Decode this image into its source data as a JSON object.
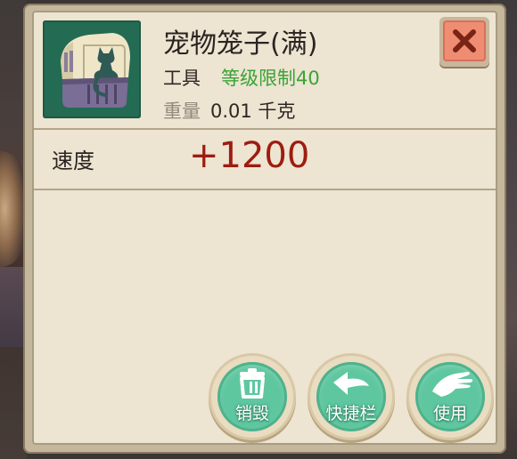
{
  "item": {
    "name": "宠物笼子(满)",
    "type": "工具",
    "level_requirement": "等级限制40",
    "weight_label": "重量",
    "weight_value": "0.01 千克",
    "icon": "pet-cage-icon"
  },
  "stats": [
    {
      "label": "速度",
      "value": "+1200"
    }
  ],
  "actions": {
    "destroy_label": "销毁",
    "hotbar_label": "快捷栏",
    "use_label": "使用"
  },
  "icons": {
    "close": "close-icon",
    "destroy": "trash-icon",
    "hotbar": "arrow-left-icon",
    "use": "hand-icon"
  },
  "colors": {
    "panel_bg": "#ede4d2",
    "level_green": "#3aa335",
    "stat_red": "#9d1c10",
    "button_green": "#5fc7a0",
    "close_red": "#ef8d72"
  }
}
